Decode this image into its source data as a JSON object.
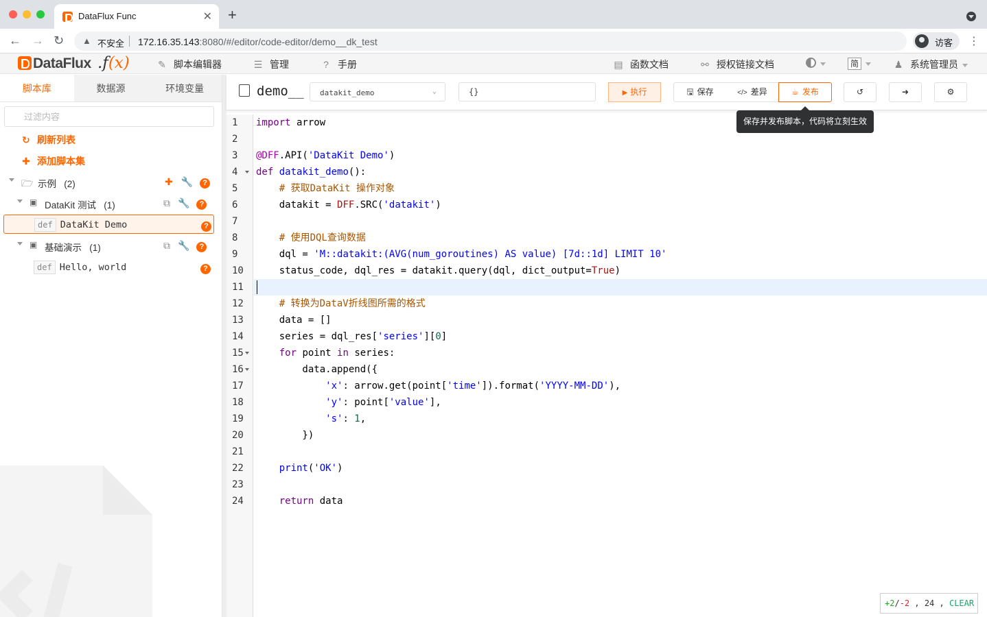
{
  "browser": {
    "tab_title": "DataFlux Func",
    "security_label": "不安全",
    "url_host": "172.16.35.143",
    "url_rest": ":8080/#/editor/code-editor/demo__dk_test",
    "profile_label": "访客"
  },
  "header": {
    "logo_text": "DataFlux",
    "logo_suffix": ".f",
    "logo_x": "(x)",
    "nav": {
      "script_editor": "脚本编辑器",
      "manage": "管理",
      "manual": "手册",
      "func_docs": "函数文档",
      "auth_link_docs": "授权链接文档",
      "lang": "简",
      "user": "系统管理员"
    }
  },
  "sidebar": {
    "tabs": [
      "脚本库",
      "数据源",
      "环境变量"
    ],
    "active_tab": 0,
    "filter_placeholder": "过滤内容",
    "refresh_label": "刷新列表",
    "add_set_label": "添加脚本集",
    "tree": {
      "set_label": "示例",
      "set_count": "(2)",
      "script1_label": "DataKit 测试",
      "script1_count": "(1)",
      "func1_tag": "def",
      "func1_label": "DataKit Demo",
      "script2_label": "基础演示",
      "script2_count": "(1)",
      "func2_tag": "def",
      "func2_label": "Hello, world"
    }
  },
  "editor": {
    "title": "demo__",
    "func_select": "datakit_demo",
    "args_input": "{}",
    "run_label": "执行",
    "save_label": "保存",
    "diff_label": "差异",
    "publish_label": "发布",
    "tooltip": "保存并发布脚本，代码将立刻生效",
    "status": {
      "added": "+2",
      "removed": "-2",
      "line": "24",
      "clear": "CLEAR"
    },
    "line_numbers": [
      "1",
      "2",
      "3",
      "4",
      "5",
      "6",
      "7",
      "8",
      "9",
      "10",
      "11",
      "12",
      "13",
      "14",
      "15",
      "16",
      "17",
      "18",
      "19",
      "20",
      "21",
      "22",
      "23",
      "24"
    ]
  },
  "code": {
    "l1_kw": "import",
    "l1_rest": " arrow",
    "l3_dec": "@DFF",
    "l3_a": ".API(",
    "l3_str": "'DataKit Demo'",
    "l3_b": ")",
    "l4_kw": "def",
    "l4_sp": " ",
    "l4_fn": "datakit_demo",
    "l4_rest": "():",
    "l5_cm": "    # 获取DataKit 操作对象",
    "l6_a": "    datakit = ",
    "l6_b": "DFF",
    "l6_c": ".SRC(",
    "l6_str": "'datakit'",
    "l6_d": ")",
    "l8_cm": "    # 使用DQL查询数据",
    "l9_a": "    dql = ",
    "l9_str": "'M::datakit:(AVG(num_goroutines) AS value) [7d::1d] LIMIT 10'",
    "l10_a": "    status_code, dql_res = datakit.query(dql, dict_output=",
    "l10_atom": "True",
    "l10_b": ")",
    "l12_cm": "    # 转换为DataV折线图所需的格式",
    "l13_a": "    data = []",
    "l14_a": "    series = dql_res[",
    "l14_str": "'series'",
    "l14_b": "][",
    "l14_num": "0",
    "l14_c": "]",
    "l15_kw": "    for",
    "l15_a": " point ",
    "l15_kw2": "in",
    "l15_b": " series:",
    "l16_a": "        data.append({",
    "l17_s1": "            'x'",
    "l17_a": ": arrow.get(point[",
    "l17_s2": "'time'",
    "l17_b": "]).format(",
    "l17_s3": "'YYYY-MM-DD'",
    "l17_c": "),",
    "l18_s1": "            'y'",
    "l18_a": ": point[",
    "l18_s2": "'value'",
    "l18_b": "],",
    "l19_s1": "            's'",
    "l19_a": ": ",
    "l19_num": "1",
    "l19_b": ",",
    "l20_a": "        })",
    "l22_fn": "    print",
    "l22_a": "(",
    "l22_str": "'OK'",
    "l22_b": ")",
    "l24_kw": "    return",
    "l24_a": " data"
  }
}
